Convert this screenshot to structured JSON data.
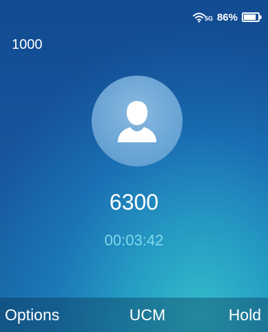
{
  "status_bar": {
    "wifi_icon": "wifi-icon",
    "network_label": "5G",
    "battery_percent": "86%",
    "battery_level": 0.86,
    "battery_icon": "battery-icon"
  },
  "account": "1000",
  "call": {
    "avatar_icon": "person-icon",
    "number": "6300",
    "duration": "00:03:42"
  },
  "softkeys": {
    "left": "Options",
    "middle": "UCM",
    "right": "Hold"
  },
  "colors": {
    "duration_text": "#7fd8ec",
    "background_top": "#16549b",
    "background_bottom": "#35b9c9"
  }
}
